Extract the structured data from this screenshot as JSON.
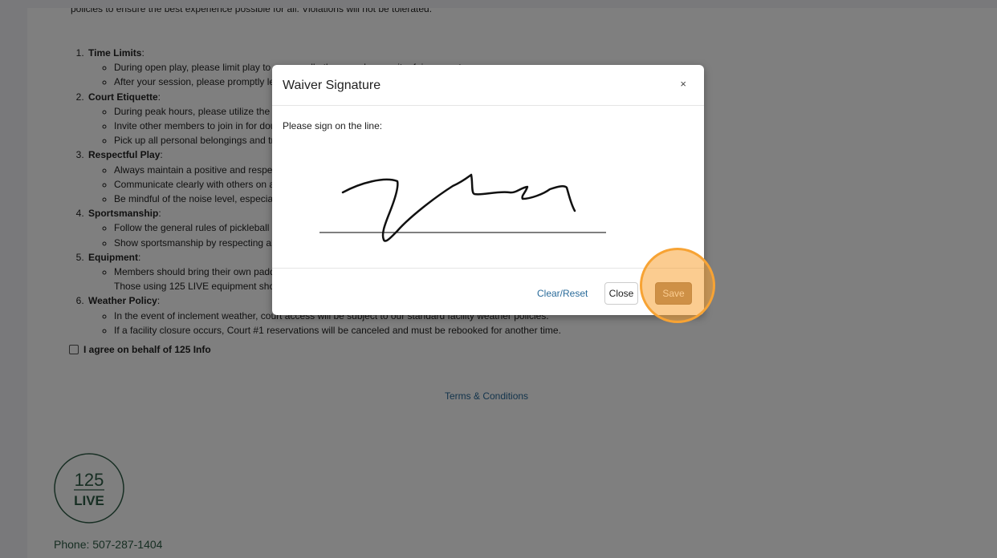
{
  "intro": "policies to ensure the best experience possible for all. Violations will not be tolerated.",
  "rules": [
    {
      "title": "Time Limits",
      "items": [
        "During open play, please limit play to ensure all other members wait a fair amount.",
        "After your session, please promptly leave the court for the next group."
      ]
    },
    {
      "title": "Court Etiquette",
      "items": [
        "During peak hours, please utilize the waitlist system.",
        "Invite other members to join in for doubles play when possible.",
        "Pick up all personal belongings and trash before leaving."
      ]
    },
    {
      "title": "Respectful Play",
      "items": [
        "Always maintain a positive and respectful attitude.",
        "Communicate clearly with others on adjacent courts.",
        "Be mindful of the noise level, especially early and late."
      ]
    },
    {
      "title": "Sportsmanship",
      "items": [
        "Follow the general rules of pickleball at all times.",
        "Show sportsmanship by respecting all players."
      ]
    },
    {
      "title": "Equipment",
      "items": [
        "Members should bring their own paddles and balls to the court.\nThose using 125 LIVE equipment should return it after play."
      ]
    },
    {
      "title": "Weather Policy",
      "items": [
        "In the event of inclement weather, court access will be subject to our standard facility weather policies.",
        "If a facility closure occurs, Court #1 reservations will be canceled and must be rebooked for another time."
      ]
    }
  ],
  "agree_label": "I agree on behalf of 125 Info",
  "terms_link": "Terms & Conditions",
  "logo": {
    "number": "125",
    "word": "LIVE"
  },
  "phone": "Phone: 507-287-1404",
  "modal": {
    "title": "Waiver Signature",
    "close_glyph": "×",
    "prompt": "Please sign on the line:",
    "clear_label": "Clear/Reset",
    "close_label": "Close",
    "save_label": "Save"
  },
  "colors": {
    "accent_green": "#2e5c46",
    "save_brown": "#9c7a5b",
    "highlight_orange": "#f7a334",
    "link_blue": "#2a6b9a"
  }
}
